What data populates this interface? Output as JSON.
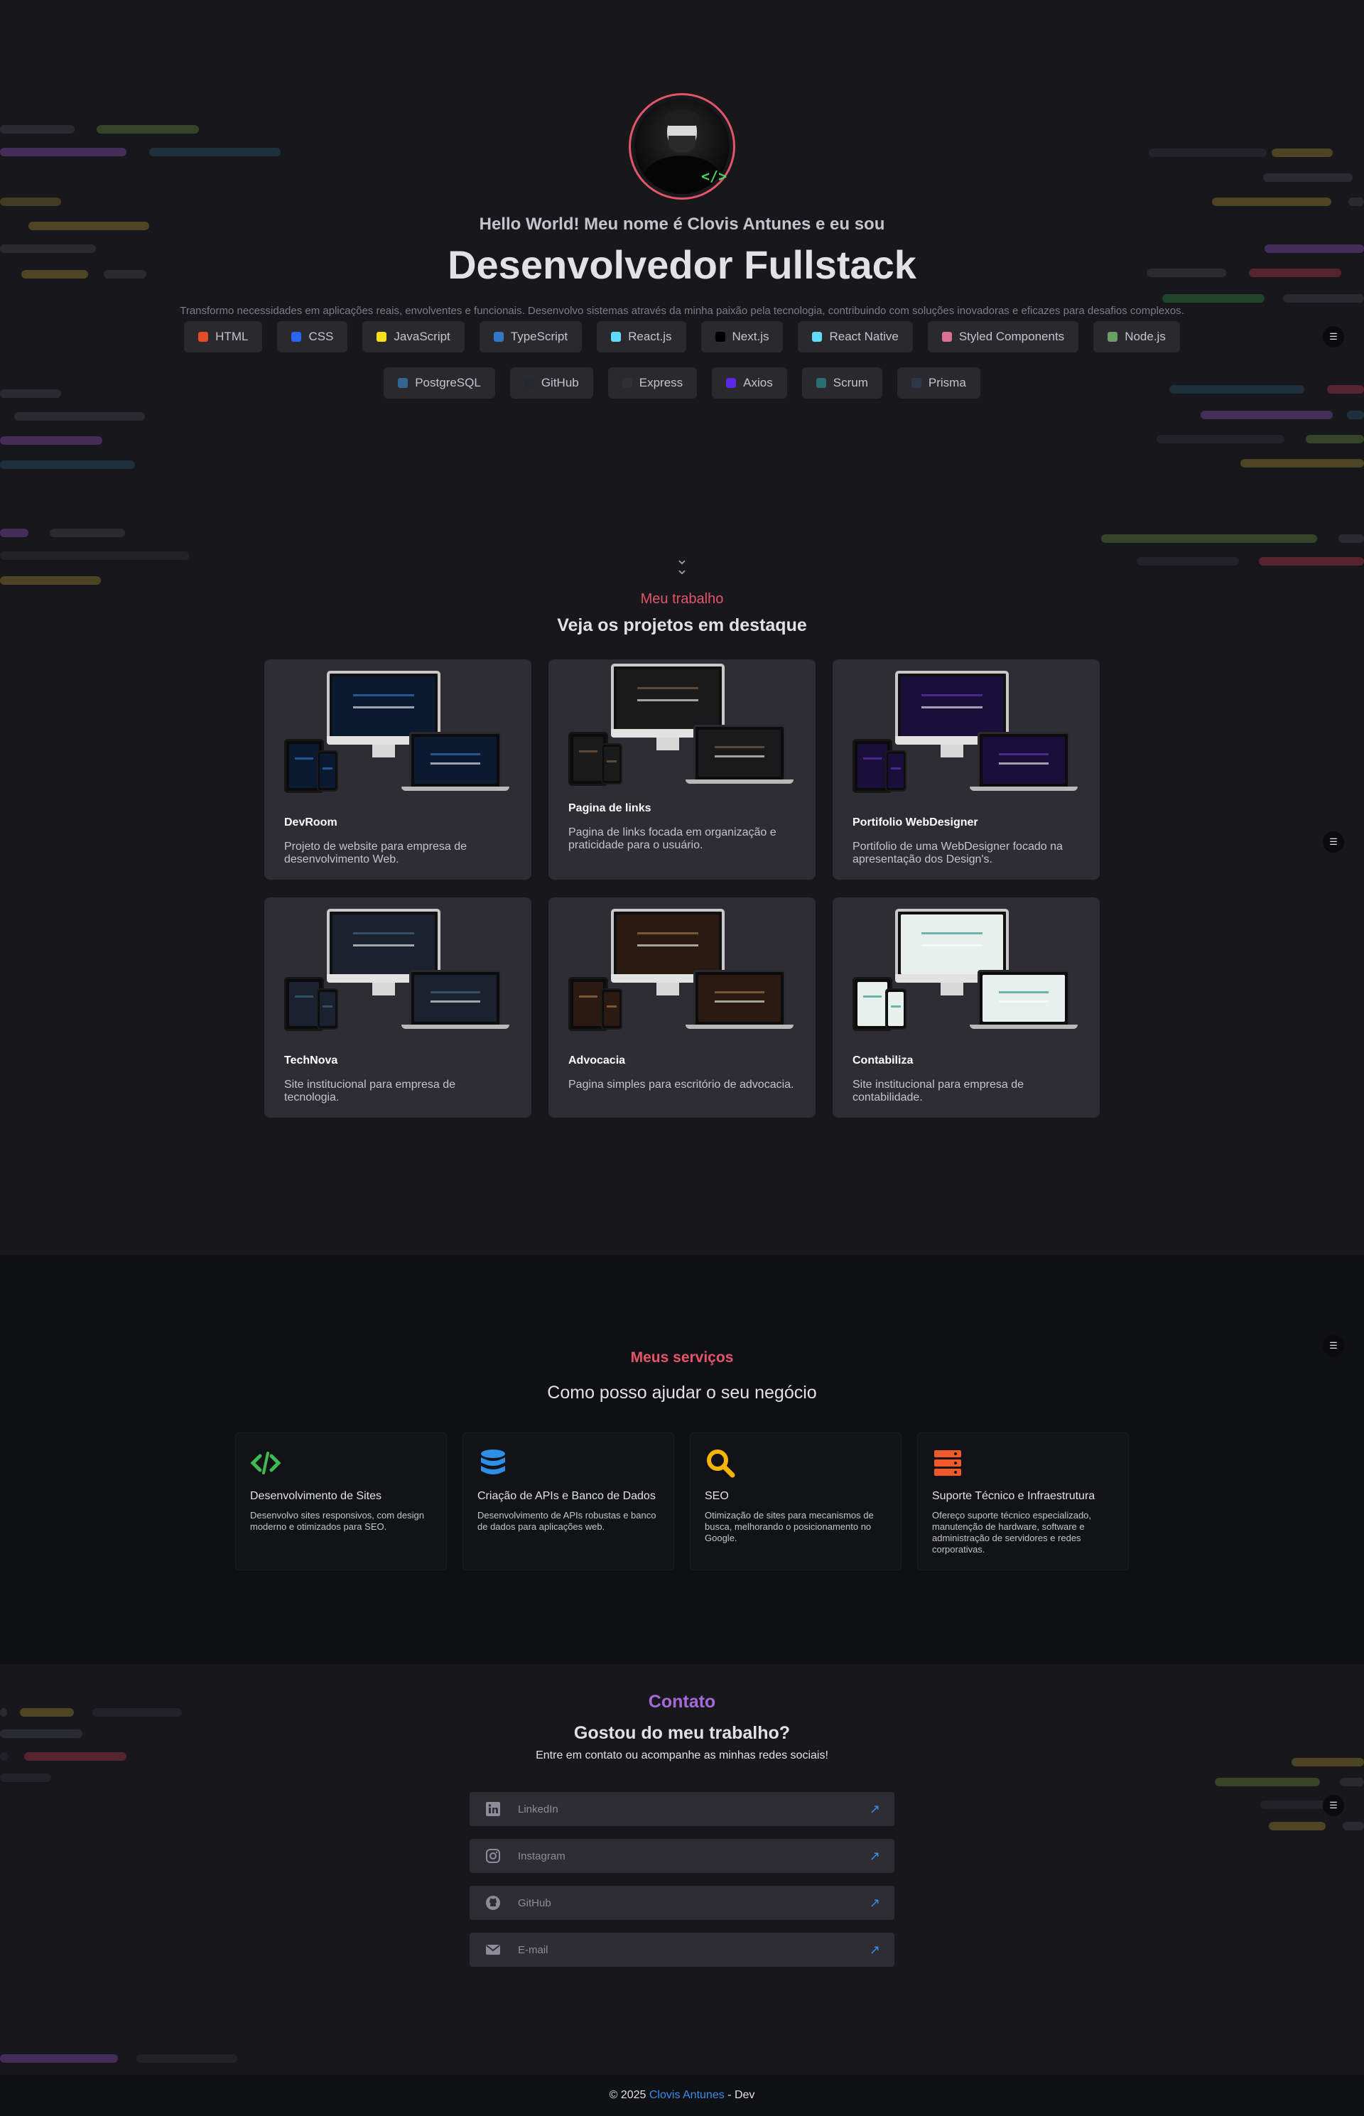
{
  "hero": {
    "greeting_pre": "Hello World! Meu nome é",
    "greeting_name": "Clovis Antunes",
    "greeting_post": "e eu sou",
    "role": "Desenvolvedor Fullstack",
    "tagline": "Transformo necessidades em aplicações reais, envolventes e funcionais. Desenvolvo sistemas através da minha paixão pela tecnologia, contribuindo com soluções inovadoras e eficazes para desafios complexos.",
    "avatar_badge": "</>",
    "skills_row1": [
      {
        "label": "HTML",
        "icon": "html5-icon",
        "color": "#e44d26"
      },
      {
        "label": "CSS",
        "icon": "css3-icon",
        "color": "#2965f1"
      },
      {
        "label": "JavaScript",
        "icon": "javascript-icon",
        "color": "#f7df1e"
      },
      {
        "label": "TypeScript",
        "icon": "typescript-icon",
        "color": "#3178c6"
      },
      {
        "label": "React.js",
        "icon": "react-icon",
        "color": "#61dafb"
      },
      {
        "label": "Next.js",
        "icon": "nextjs-icon",
        "color": "#000000"
      },
      {
        "label": "React Native",
        "icon": "react-icon",
        "color": "#61dafb"
      },
      {
        "label": "Styled Components",
        "icon": "styled-components-icon",
        "color": "#db7093"
      },
      {
        "label": "Node.js",
        "icon": "nodejs-icon",
        "color": "#68a063"
      }
    ],
    "skills_row2": [
      {
        "label": "PostgreSQL",
        "icon": "postgresql-icon",
        "color": "#336791"
      },
      {
        "label": "GitHub",
        "icon": "github-icon",
        "color": "#24292e"
      },
      {
        "label": "Express",
        "icon": "express-icon",
        "color": "#303030"
      },
      {
        "label": "Axios",
        "icon": "axios-icon",
        "color": "#5a29e4"
      },
      {
        "label": "Scrum",
        "icon": "scrum-icon",
        "color": "#2a6f70"
      },
      {
        "label": "Prisma",
        "icon": "prisma-icon",
        "color": "#2d3748"
      }
    ]
  },
  "work": {
    "kicker": "Meu trabalho",
    "title": "Veja os projetos em destaque",
    "projects": [
      {
        "title": "DevRoom",
        "desc": "Projeto de website para empresa de desenvolvimento Web.",
        "screen": "#0b1a2e",
        "accent": "#3a7bd5"
      },
      {
        "title": "Pagina de links",
        "desc": "Pagina de links focada em organização e praticidade para o usuário.",
        "screen": "#1a1a1a",
        "accent": "#8a6a4a"
      },
      {
        "title": "Portifolio WebDesigner",
        "desc": "Portifolio de uma WebDesigner focado na apresentação dos Design's.",
        "screen": "#1a0f3a",
        "accent": "#6a3ac8"
      },
      {
        "title": "TechNova",
        "desc": "Site institucional para empresa de tecnologia.",
        "screen": "#1a2230",
        "accent": "#4a6a8a"
      },
      {
        "title": "Advocacia",
        "desc": "Pagina simples para escritório de advocacia.",
        "screen": "#2a1a12",
        "accent": "#b08050"
      },
      {
        "title": "Contabiliza",
        "desc": "Site institucional para empresa de contabilidade.",
        "screen": "#e8f0ee",
        "accent": "#1a8a7a"
      }
    ]
  },
  "services": {
    "kicker": "Meus serviços",
    "title": "Como posso ajudar o seu negócio",
    "items": [
      {
        "title": "Desenvolvimento de Sites",
        "desc": "Desenvolvo sites responsivos, com design moderno e otimizados para SEO.",
        "icon": "code-icon",
        "color": "#3fb950"
      },
      {
        "title": "Criação de APIs e Banco de Dados",
        "desc": "Desenvolvimento de APIs robustas e banco de dados para aplicações web.",
        "icon": "database-icon",
        "color": "#2d8fe8"
      },
      {
        "title": "SEO",
        "desc": "Otimização de sites para mecanismos de busca, melhorando o posicionamento no Google.",
        "icon": "search-icon",
        "color": "#f5b400"
      },
      {
        "title": "Suporte Técnico e Infraestrutura",
        "desc": "Ofereço suporte técnico especializado, manutenção de hardware, software e administração de servidores e redes corporativas.",
        "icon": "server-icon",
        "color": "#f0592a"
      }
    ]
  },
  "contact": {
    "kicker": "Contato",
    "title": "Gostou do meu trabalho?",
    "subtitle": "Entre em contato ou acompanhe as minhas redes sociais!",
    "links": [
      {
        "label": "LinkedIn",
        "icon": "linkedin-icon"
      },
      {
        "label": "Instagram",
        "icon": "instagram-icon"
      },
      {
        "label": "GitHub",
        "icon": "github-icon"
      },
      {
        "label": "E-mail",
        "icon": "mail-icon"
      }
    ]
  },
  "footer": {
    "prefix": "© 2025",
    "name": "Clovis Antunes",
    "suffix": "- Dev"
  },
  "colors": {
    "accent_red": "#e3566a",
    "accent_purple": "#a46bd8",
    "accent_blue": "#3b8ee8",
    "background": "#18181c"
  }
}
